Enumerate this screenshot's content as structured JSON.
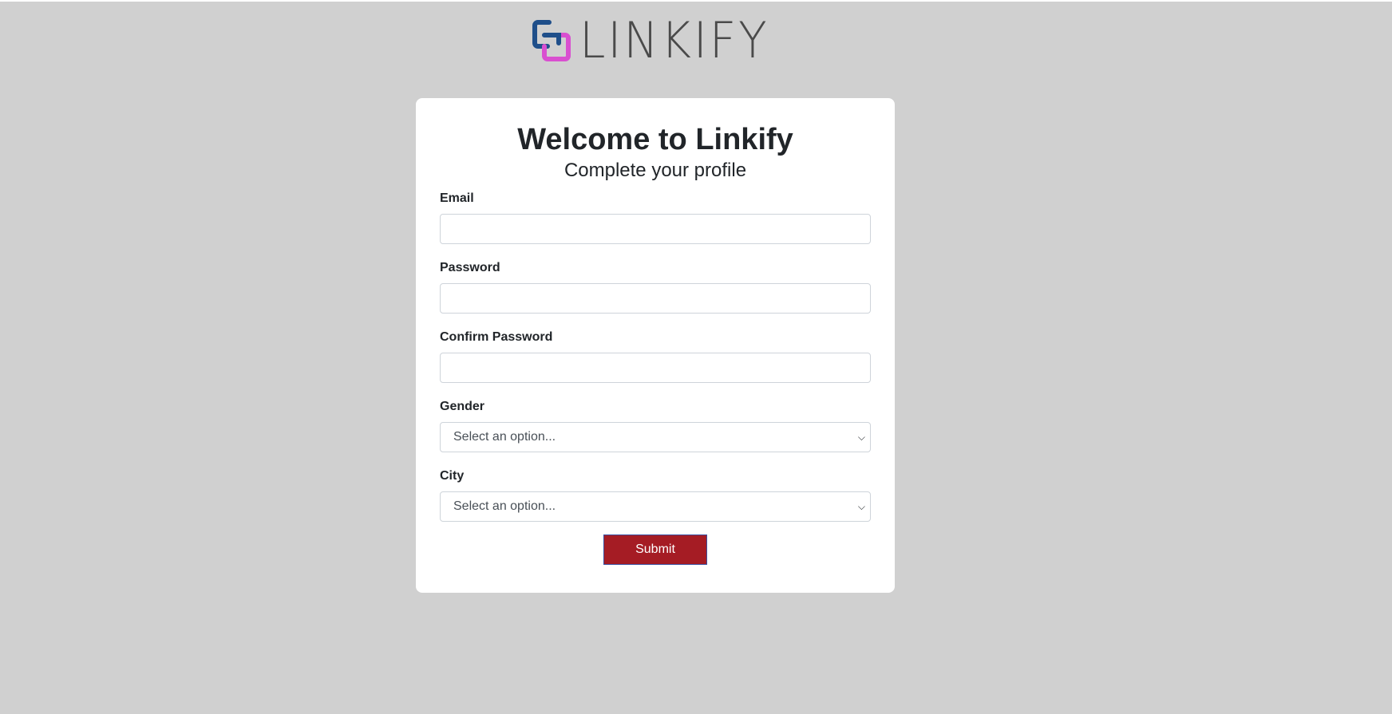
{
  "brand": {
    "name": "LINKIFY",
    "colors": {
      "blue": "#1f4f8a",
      "pink": "#d94fd0"
    }
  },
  "card": {
    "title": "Welcome to Linkify",
    "subtitle": "Complete your profile"
  },
  "form": {
    "email_label": "Email",
    "email_value": "",
    "password_label": "Password",
    "password_value": "",
    "confirm_label": "Confirm Password",
    "confirm_value": "",
    "gender_label": "Gender",
    "gender_selected": "Select an option...",
    "city_label": "City",
    "city_selected": "Select an option...",
    "submit_label": "Submit"
  },
  "colors": {
    "page_bg": "#d0d0d0",
    "submit_bg": "#a51c24"
  }
}
